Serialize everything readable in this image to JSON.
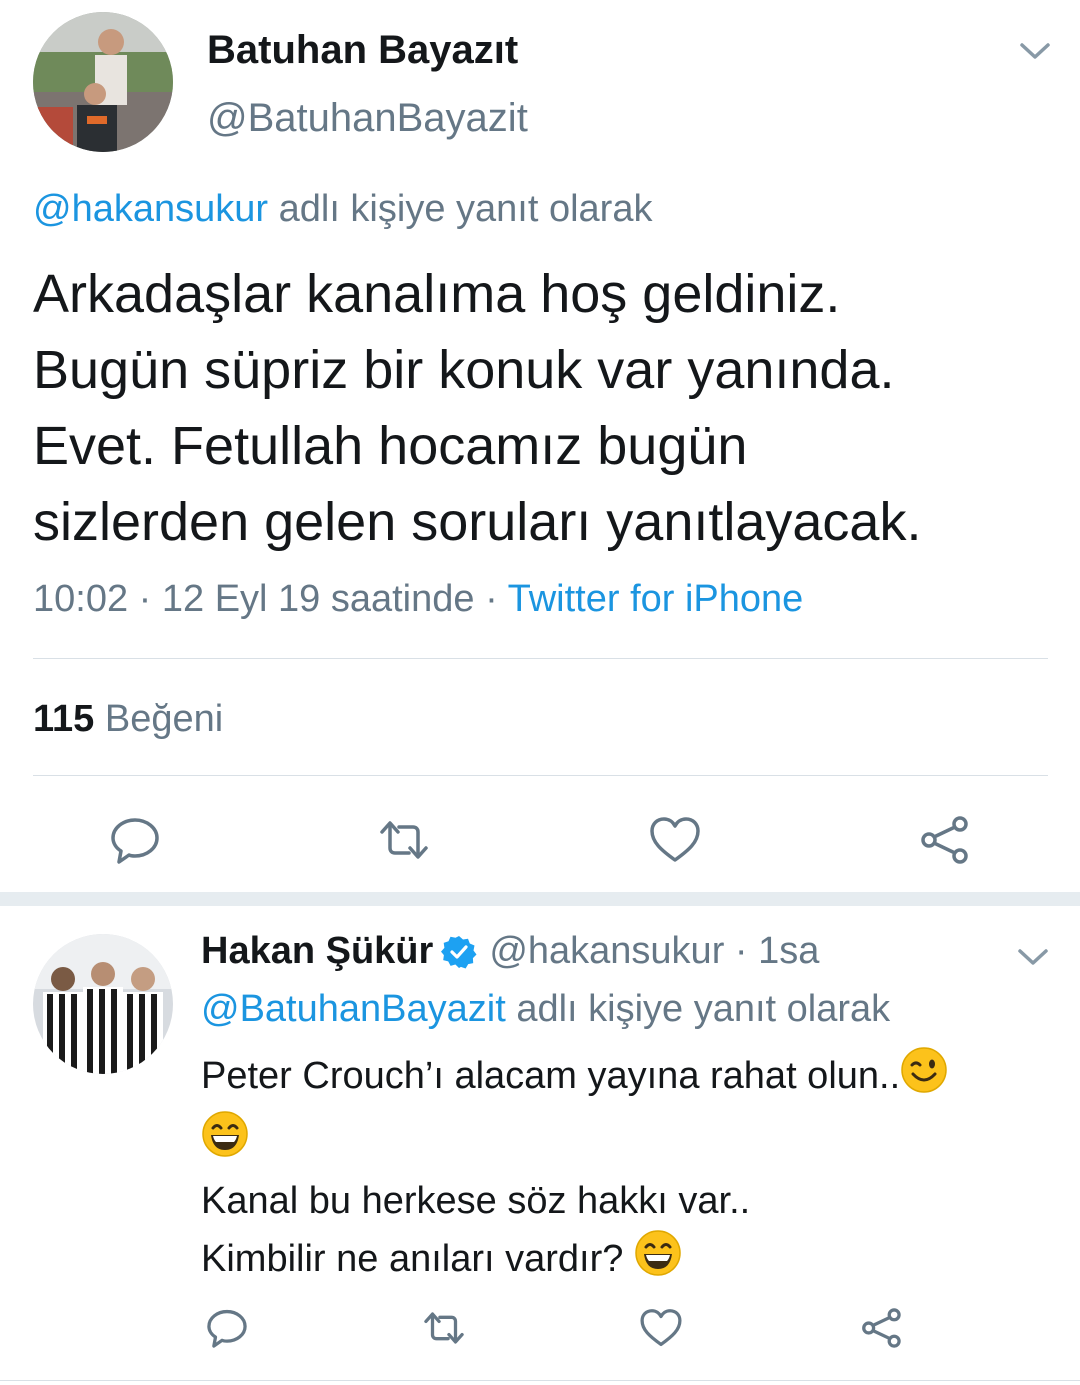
{
  "tweet": {
    "author_name": "Batuhan Bayazıt",
    "author_handle": "@BatuhanBayazit",
    "reply_to_handle": "@hakansukur",
    "reply_suffix": "adlı kişiye yanıt olarak",
    "text_lines": [
      "Arkadaşlar kanalıma hoş geldiniz.",
      "Bugün süpriz bir konuk var yanında.",
      "Evet. Fetullah hocamız bugün",
      "sizlerden gelen soruları yanıtlayacak."
    ],
    "timestamp": "10:02 · 12 Eyl 19 saatinde ·",
    "source": "Twitter for iPhone",
    "like_count": "115",
    "like_label": "Beğeni"
  },
  "reply": {
    "author_name": "Hakan Şükür",
    "author_handle": "@hakansukur · 1sa",
    "reply_to_handle": "@BatuhanBayazit",
    "reply_suffix": "adlı kişiye yanıt olarak",
    "line1": "Peter Crouch’ı alacam yayına rahat olun..",
    "line3": "Kanal bu herkese söz hakkı var..",
    "line4": "Kimbilir ne anıları vardır?"
  },
  "icons": {
    "reply": "comment-icon",
    "retweet": "retweet-icon",
    "like": "heart-icon",
    "share": "share-icon",
    "verified": "verified-badge-icon",
    "menu": "chevron-down-icon"
  },
  "colors": {
    "link": "#1b95e0",
    "secondary_text": "#657786",
    "primary_text": "#14171a",
    "divider": "#d9e0e6",
    "separator": "#e6ecf0"
  }
}
